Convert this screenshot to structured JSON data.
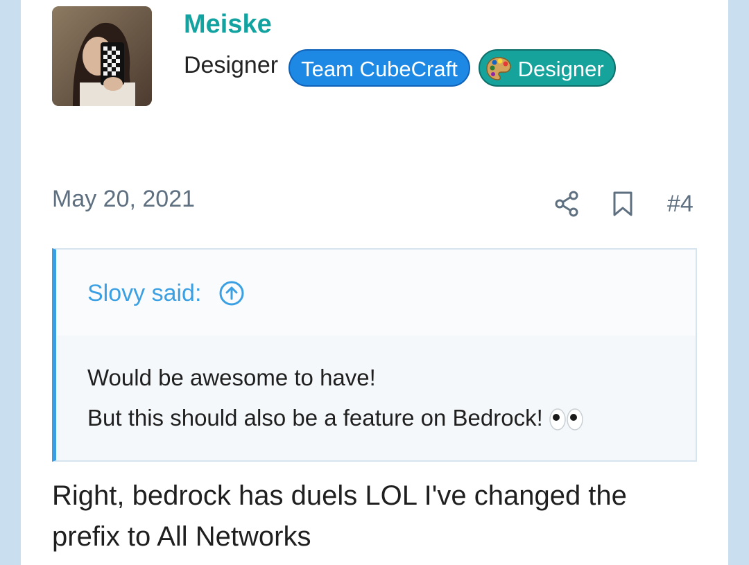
{
  "user": {
    "avatar_icon": "user-avatar-photo",
    "name": "Meiske",
    "title": "Designer",
    "banners": [
      {
        "label": "Team CubeCraft",
        "color": "#1e88e5"
      },
      {
        "label": "Designer",
        "icon": "artist-palette-icon",
        "color": "#16a39c"
      }
    ]
  },
  "post": {
    "date": "May 20, 2021",
    "share_icon": "share-icon",
    "bookmark_icon": "bookmark-icon",
    "number": "#4"
  },
  "quote": {
    "author_label": "Slovy said:",
    "expand_icon": "arrow-up-circle-icon",
    "lines": [
      "Would be awesome to have!",
      "But this should also be a feature on Bedrock!"
    ],
    "emoji": "eyes-icon"
  },
  "reply": {
    "lines": [
      "Right, bedrock has duels LOL I've changed the",
      "prefix to All Networks"
    ]
  },
  "colors": {
    "username": "#12a3a0",
    "quote_accent": "#3ba0e3",
    "background": "#c9dff0"
  }
}
